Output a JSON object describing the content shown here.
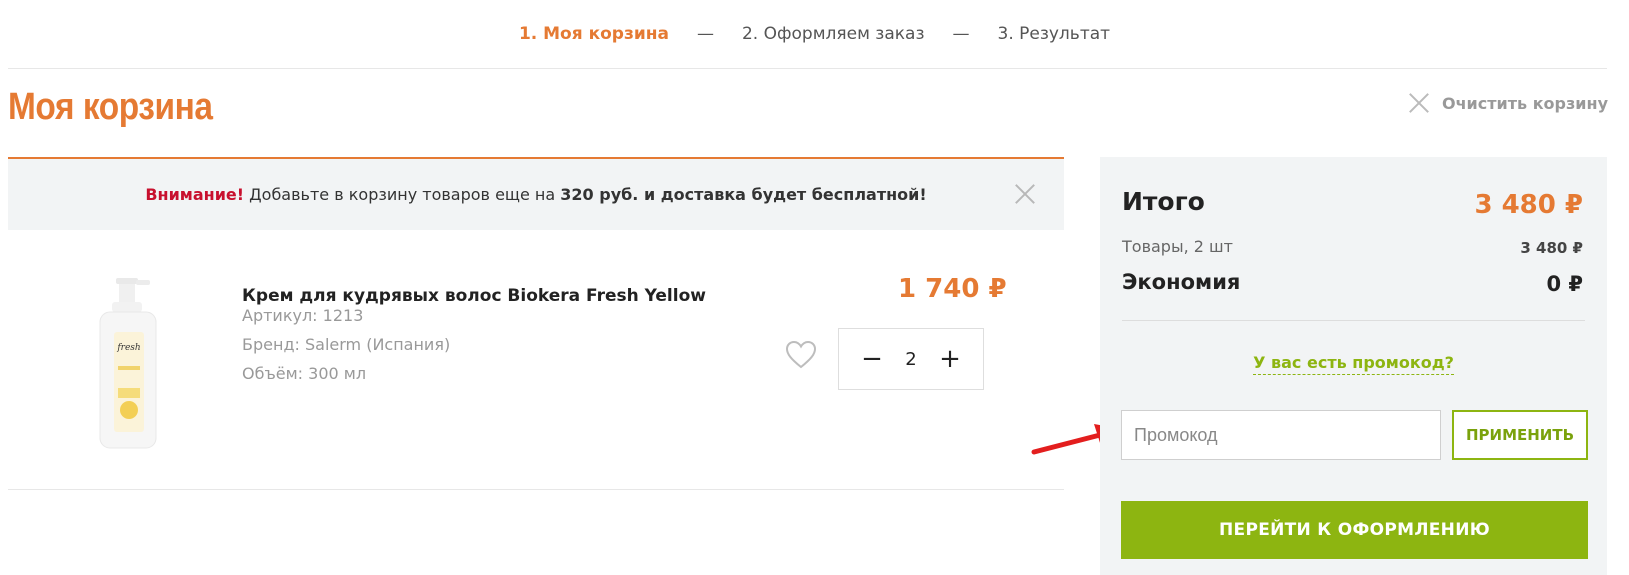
{
  "steps": {
    "step1": "1. Моя корзина",
    "sep": "—",
    "step2": "2. Оформляем заказ",
    "step3": "3. Результат"
  },
  "page": {
    "title": "Моя корзина",
    "clear_cart": "Очистить корзину"
  },
  "notice": {
    "attention": "Внимание!",
    "text1": " Добавьте в корзину товаров еще на ",
    "amount": "320 руб. и доставка будет бесплатной!"
  },
  "product": {
    "name": "Крем для кудрявых волос Biokera Fresh Yellow",
    "article": "Артикул: 1213",
    "brand": "Бренд: Salerm (Испания)",
    "volume": "Объём: 300 мл",
    "price": "1 740 ₽",
    "quantity": "2",
    "minus": "−",
    "plus": "+"
  },
  "summary": {
    "total_label": "Итого",
    "total_value": "3 480 ₽",
    "goods_label": "Товары, 2 шт",
    "goods_value": "3 480 ₽",
    "economy_label": "Экономия",
    "economy_value": "0 ₽",
    "promo_link": "У вас есть промокод?",
    "promo_placeholder": "Промокод",
    "apply_label": "ПРИМЕНИТЬ",
    "checkout_label": "ПЕРЕЙТИ К ОФОРМЛЕНИЮ"
  },
  "colors": {
    "accent_orange": "#e57a33",
    "accent_green": "#8db511",
    "attention_red": "#c8102e",
    "annotation_arrow": "#e31e1e"
  },
  "icons": {
    "clear": "close-x-icon",
    "notice_close": "close-x-icon",
    "favorite": "heart-outline-icon",
    "annotation": "red-arrow-icon"
  }
}
